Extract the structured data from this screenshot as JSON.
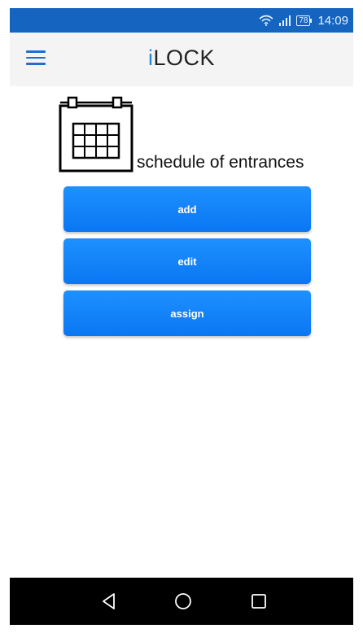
{
  "status_bar": {
    "battery": "78",
    "time": "14:09",
    "icons": [
      "wifi-icon",
      "signal-icon",
      "battery-icon"
    ],
    "background": "#1565c0"
  },
  "header": {
    "title_prefix": "i",
    "title_rest": "LOCK",
    "menu_icon": "hamburger-menu-icon",
    "accent": "#1e88e5"
  },
  "main": {
    "icon": "calendar-icon",
    "section_title": "schedule of entrances",
    "buttons": [
      {
        "label": "add"
      },
      {
        "label": "edit"
      },
      {
        "label": "assign"
      }
    ],
    "button_color": "#0a84ff"
  },
  "nav_bar": {
    "icons": [
      "back-icon",
      "home-icon",
      "recent-apps-icon"
    ]
  }
}
